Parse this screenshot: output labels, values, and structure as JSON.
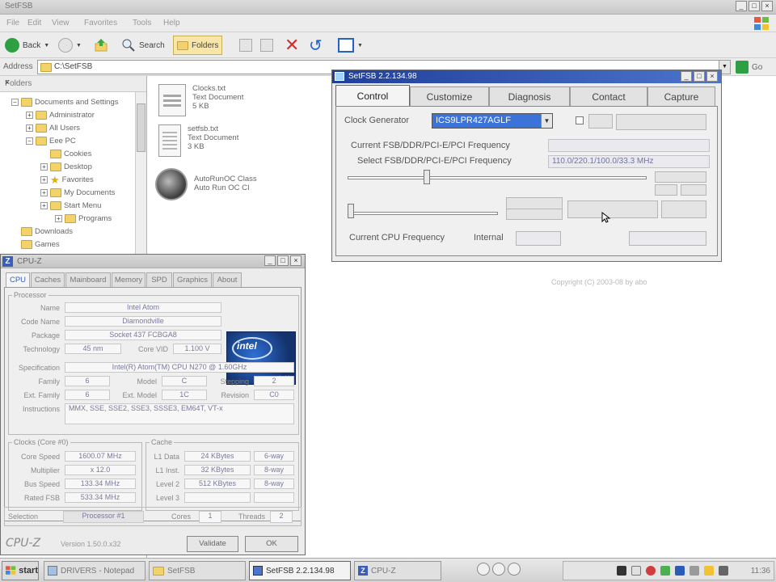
{
  "colors": {
    "accent_blue": "#3c73d8",
    "titlebar_blue": "#1f3f9a",
    "folder_yellow": "#f2d36b",
    "go_green": "#2ea043"
  },
  "explorer": {
    "title": "SetFSB",
    "menu": [
      "File",
      "Edit",
      "View",
      "Favorites",
      "Tools",
      "Help"
    ],
    "toolbar": {
      "back": "Back",
      "search": "Search",
      "folders": "Folders"
    },
    "address": {
      "label": "Address",
      "value": "C:\\SetFSB",
      "go": "Go"
    },
    "folders_panel": {
      "title": "Folders",
      "items": [
        {
          "label": "Documents and Settings",
          "indent": 0,
          "expander": "−"
        },
        {
          "label": "Administrator",
          "indent": 1,
          "expander": "+"
        },
        {
          "label": "All Users",
          "indent": 1,
          "expander": "+"
        },
        {
          "label": "Eee PC",
          "indent": 1,
          "expander": "−"
        },
        {
          "label": "Cookies",
          "indent": 2,
          "expander": ""
        },
        {
          "label": "Desktop",
          "indent": 2,
          "expander": "+"
        },
        {
          "label": "Favorites",
          "indent": 2,
          "expander": "+"
        },
        {
          "label": "My Documents",
          "indent": 2,
          "expander": "+"
        },
        {
          "label": "Start Menu",
          "indent": 2,
          "expander": "+"
        },
        {
          "label": "Programs",
          "indent": 3,
          "expander": "+"
        },
        {
          "label": "Downloads",
          "indent": 0,
          "expander": ""
        },
        {
          "label": "Games",
          "indent": 0,
          "expander": ""
        }
      ]
    },
    "files": [
      {
        "name": "Clocks.txt",
        "desc": "Text Document",
        "size": "5 KB"
      },
      {
        "name": "setfsb.txt",
        "desc": "Text Document",
        "size": "3 KB"
      },
      {
        "name": "AutoRunOC Class",
        "desc": "Auto Run OC CI"
      }
    ]
  },
  "setfsb": {
    "title": "SetFSB 2.2.134.98",
    "tabs": [
      "Control",
      "Customize",
      "Diagnosis",
      "Contact",
      "Capture"
    ],
    "clock_generator_label": "Clock Generator",
    "clock_generator_value": "ICS9LPR427AGLF",
    "current_freq_label": "Current FSB/DDR/PCI-E/PCI Frequency",
    "select_freq_label": "Select FSB/DDR/PCI-E/PCI Frequency",
    "select_freq_value": "110.0/220.1/100.0/33.3 MHz",
    "current_cpu_label": "Current CPU Frequency",
    "internal_label": "Internal",
    "copyright": "Copyright (C) 2003-08 by abo"
  },
  "cpuz": {
    "title": "CPU-Z",
    "tabs": [
      "CPU",
      "Caches",
      "Mainboard",
      "Memory",
      "SPD",
      "Graphics",
      "About"
    ],
    "processor_legend": "Processor",
    "processor": [
      {
        "label": "Name",
        "value": "Intel Atom"
      },
      {
        "label": "Code Name",
        "value": "Diamondville"
      },
      {
        "label": "Package",
        "value": "Socket 437 FCBGA8"
      },
      {
        "label": "Technology",
        "value": "45 nm"
      }
    ],
    "core_vid_label": "Core VID",
    "core_vid_value": "1.100 V",
    "specification_label": "Specification",
    "specification_value": "Intel(R) Atom(TM) CPU N270 @ 1.60GHz",
    "family": {
      "label": "Family",
      "value": "6"
    },
    "model": {
      "label": "Model",
      "value": "C"
    },
    "stepping": {
      "label": "Stepping",
      "value": "2"
    },
    "ext_family": {
      "label": "Ext. Family",
      "value": "6"
    },
    "ext_model": {
      "label": "Ext. Model",
      "value": "1C"
    },
    "revision": {
      "label": "Revision",
      "value": "C0"
    },
    "instructions_label": "Instructions",
    "instructions_value": "MMX, SSE, SSE2, SSE3, SSSE3, EM64T, VT-x",
    "clocks_legend": "Clocks (Core #0)",
    "clocks": [
      {
        "label": "Core Speed",
        "value": "1600.07 MHz"
      },
      {
        "label": "Multiplier",
        "value": "x 12.0"
      },
      {
        "label": "Bus Speed",
        "value": "133.34 MHz"
      },
      {
        "label": "Rated FSB",
        "value": "533.34 MHz"
      }
    ],
    "cache_legend": "Cache",
    "cache": [
      {
        "label": "L1 Data",
        "value": "24 KBytes",
        "assoc": "6-way"
      },
      {
        "label": "L1 Inst.",
        "value": "32 KBytes",
        "assoc": "8-way"
      },
      {
        "label": "Level 2",
        "value": "512 KBytes",
        "assoc": "8-way"
      },
      {
        "label": "Level 3",
        "value": "",
        "assoc": ""
      }
    ],
    "selection_label": "Selection",
    "selection_value": "Processor #1",
    "cores_label": "Cores",
    "cores_value": "1",
    "threads_label": "Threads",
    "threads_value": "2",
    "brand": "CPU-Z",
    "version": "Version 1.50.0.x32",
    "validate": "Validate",
    "ok": "OK"
  },
  "taskbar": {
    "start": "start",
    "tasks": [
      "DRIVERS - Notepad",
      "SetFSB",
      "SetFSB 2.2.134.98",
      "CPU-Z"
    ],
    "clock": "11:36"
  }
}
